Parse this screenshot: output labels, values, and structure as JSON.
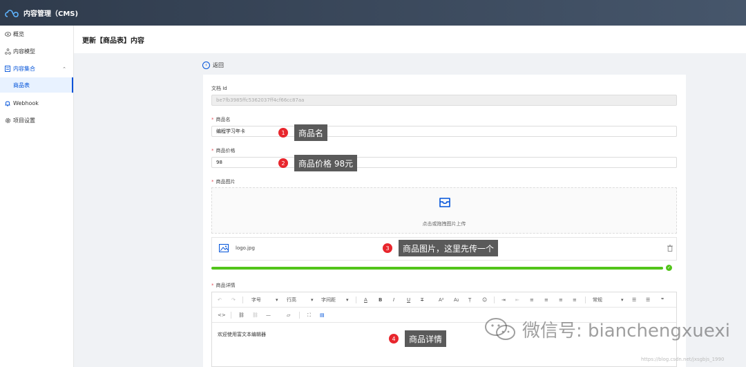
{
  "app": {
    "title": "内容管理（CMS)"
  },
  "sidebar": {
    "items": [
      {
        "label": "概览",
        "icon": "eye-icon"
      },
      {
        "label": "内容模型",
        "icon": "model-icon"
      },
      {
        "label": "内容集合",
        "icon": "collection-icon",
        "expanded": true
      },
      {
        "label": "商品表",
        "icon": "",
        "active": true
      },
      {
        "label": "Webhook",
        "icon": "bell-icon"
      },
      {
        "label": "项目设置",
        "icon": "gear-icon"
      }
    ]
  },
  "header": {
    "title": "更新【商品表】内容"
  },
  "back": {
    "label": "返回"
  },
  "form": {
    "doc_id": {
      "label": "文档 Id",
      "value": "be7fb3985ffc5362037ff4cf66cc87aa"
    },
    "name": {
      "label": "商品名",
      "value": "编程学习年卡"
    },
    "price": {
      "label": "商品价格",
      "value": "98"
    },
    "image": {
      "label": "商品图片",
      "upload_hint": "点击或拖拽图片上传",
      "file_name": "logo.jpg",
      "upload_progress": 1.0
    },
    "detail": {
      "label": "商品详情",
      "content": "欢迎使用富文本编辑器",
      "toolbar": {
        "font_size": "字号",
        "line_height": "行高",
        "letter_spacing": "字间距",
        "paragraph_style": "常规"
      }
    }
  },
  "annotations": [
    {
      "num": "1",
      "text": "商品名"
    },
    {
      "num": "2",
      "text": "商品价格 98元"
    },
    {
      "num": "3",
      "text": "商品图片，这里先传一个"
    },
    {
      "num": "4",
      "text": "商品详情"
    }
  ],
  "watermark": {
    "text": "微信号: bianchengxuexi",
    "url": "https://blog.csdn.net/jxsgbjs_1990"
  },
  "colors": {
    "accent": "#0052d9",
    "topbar": "#2f3b4c",
    "required": "#e34d59",
    "success": "#52c41a",
    "badge": "#e8262d"
  }
}
